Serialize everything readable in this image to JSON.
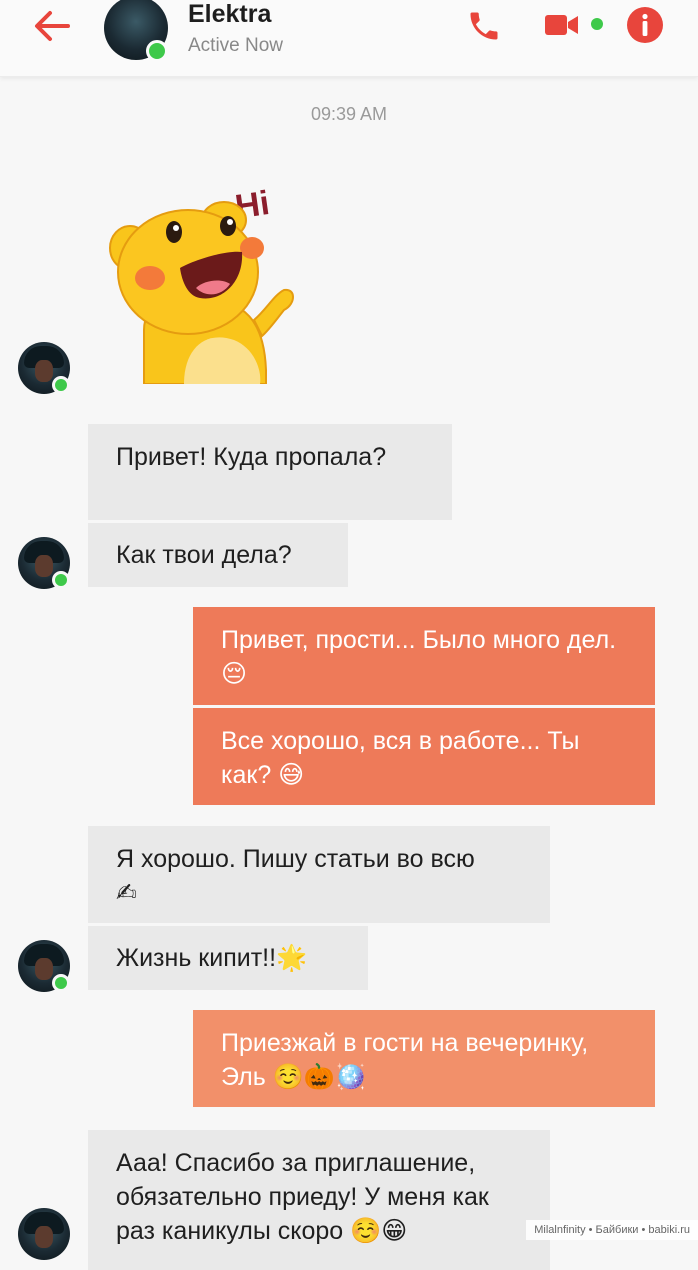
{
  "header": {
    "contact_name": "Elektra",
    "status": "Active Now",
    "icons": [
      "back-arrow-icon",
      "phone-icon",
      "video-icon",
      "info-icon"
    ],
    "accent_color": "#e8453c",
    "online_color": "#3ec94a"
  },
  "timestamp": "09:39 AM",
  "sticker": {
    "text": "Hi"
  },
  "messages": [
    {
      "from": "contact",
      "text": "Привет! Куда пропала?"
    },
    {
      "from": "contact",
      "text": "Как твои дела?"
    },
    {
      "from": "me",
      "text": "Привет, прости... Было много дел. 😔"
    },
    {
      "from": "me",
      "text": "Все хорошо, вся в работе... Ты как? 😅"
    },
    {
      "from": "contact",
      "text": "Я хорошо. Пишу статьи во всю ✍"
    },
    {
      "from": "contact",
      "text": "Жизнь кипит!!🌟"
    },
    {
      "from": "me",
      "text": "Приезжай в гости на вечеринку, Эль ☺️🎃🪩"
    },
    {
      "from": "contact",
      "text": "Ааа! Спасибо за приглашение, обязательно приеду! У меня как раз каникулы скоро ☺️😁"
    }
  ],
  "colors": {
    "incoming_bubble": "#e9e9e9",
    "outgoing_bubble": "#ee7a59",
    "outgoing_bubble_light": "#f2906a"
  },
  "watermark": "Milalnfinity • Байбики • babiki.ru"
}
